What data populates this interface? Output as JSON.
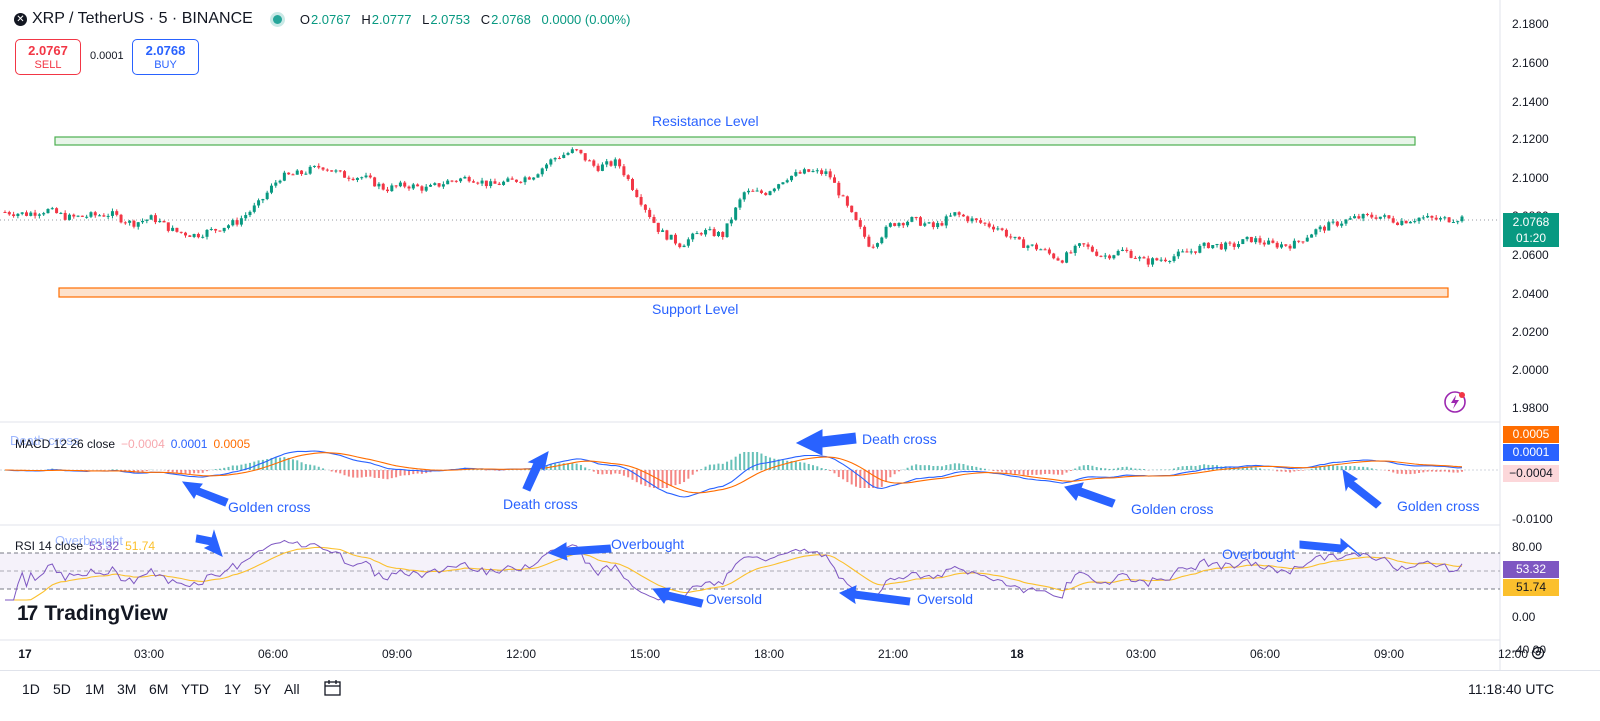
{
  "header": {
    "symbol": "XRP / TetherUS · 5 · BINANCE",
    "ohlc": {
      "o_label": "O",
      "o": "2.0767",
      "h_label": "H",
      "h": "2.0777",
      "l_label": "L",
      "l": "2.0753",
      "c_label": "C",
      "c": "2.0768",
      "change": "0.0000 (0.00%)"
    }
  },
  "trade": {
    "sell_price": "2.0767",
    "sell_label": "SELL",
    "spread": "0.0001",
    "buy_price": "2.0768",
    "buy_label": "BUY"
  },
  "indicators": {
    "macd": {
      "name": "MACD 12 26 close",
      "histogram": "−0.0004",
      "macd": "0.0001",
      "signal": "0.0005"
    },
    "rsi": {
      "name": "RSI 14 close",
      "rsi": "53.32",
      "ma": "51.74"
    }
  },
  "annotations": {
    "resistance": "Resistance Level",
    "support": "Support Level",
    "death_cross_1": "Death cross",
    "death_cross_2": "Death cross",
    "golden_cross_1": "Golden cross",
    "golden_cross_2": "Golden cross",
    "golden_cross_3": "Golden cross",
    "overbought_1": "Overbought",
    "overbought_2": "Overbought",
    "oversold_1": "Oversold",
    "oversold_2": "Oversold",
    "faint_death_cross": "Death cross",
    "faint_overbought": "Overbought"
  },
  "price_axis": [
    "2.1800",
    "2.1600",
    "2.1400",
    "2.1200",
    "2.1000",
    "2.0800",
    "2.0600",
    "2.0400",
    "2.0200",
    "2.0000",
    "1.9800"
  ],
  "macd_axis": [
    "-0.0100"
  ],
  "rsi_axis": [
    "80.00",
    "0.00",
    "-40.00"
  ],
  "price_tags": {
    "last_price": "2.0768",
    "countdown": "01:20",
    "macd_signal": "0.0005",
    "macd_line": "0.0001",
    "macd_hist": "−0.0004",
    "rsi_value": "53.32",
    "rsi_ma": "51.74"
  },
  "time_axis": [
    "17",
    "03:00",
    "06:00",
    "09:00",
    "12:00",
    "15:00",
    "18:00",
    "21:00",
    "18",
    "03:00",
    "06:00",
    "09:00",
    "12:00"
  ],
  "ranges": [
    "1D",
    "5D",
    "1M",
    "3M",
    "6M",
    "YTD",
    "1Y",
    "5Y",
    "All"
  ],
  "clock": "11:18:40 UTC",
  "logo": "TradingView",
  "colors": {
    "up": "#089981",
    "down": "#f23645",
    "macd": "#2962ff",
    "signal": "#ff6d00",
    "rsi": "#7e57c2",
    "rsi_ma": "#fbc02d",
    "annotation": "#2962ff"
  },
  "chart_data": {
    "type": "candlestick",
    "interval_minutes": 5,
    "approx_close_path": [
      [
        0,
        2.08
      ],
      [
        10,
        2.079
      ],
      [
        20,
        2.081
      ],
      [
        30,
        2.077
      ],
      [
        40,
        2.078
      ],
      [
        50,
        2.079
      ],
      [
        60,
        2.074
      ],
      [
        70,
        2.077
      ],
      [
        80,
        2.07
      ],
      [
        90,
        2.068
      ],
      [
        100,
        2.071
      ],
      [
        110,
        2.075
      ],
      [
        120,
        2.084
      ],
      [
        130,
        2.098
      ],
      [
        140,
        2.1
      ],
      [
        150,
        2.104
      ],
      [
        160,
        2.099
      ],
      [
        170,
        2.098
      ],
      [
        180,
        2.092
      ],
      [
        190,
        2.094
      ],
      [
        200,
        2.092
      ],
      [
        210,
        2.096
      ],
      [
        220,
        2.098
      ],
      [
        230,
        2.094
      ],
      [
        240,
        2.096
      ],
      [
        250,
        2.099
      ],
      [
        260,
        2.108
      ],
      [
        270,
        2.112
      ],
      [
        280,
        2.103
      ],
      [
        290,
        2.106
      ],
      [
        300,
        2.088
      ],
      [
        310,
        2.07
      ],
      [
        320,
        2.063
      ],
      [
        330,
        2.07
      ],
      [
        340,
        2.068
      ],
      [
        350,
        2.09
      ],
      [
        360,
        2.09
      ],
      [
        370,
        2.098
      ],
      [
        380,
        2.101
      ],
      [
        390,
        2.1
      ],
      [
        400,
        2.08
      ],
      [
        410,
        2.062
      ],
      [
        420,
        2.074
      ],
      [
        430,
        2.076
      ],
      [
        440,
        2.072
      ],
      [
        450,
        2.079
      ],
      [
        460,
        2.075
      ],
      [
        470,
        2.072
      ],
      [
        480,
        2.064
      ],
      [
        490,
        2.061
      ],
      [
        500,
        2.055
      ],
      [
        510,
        2.063
      ],
      [
        520,
        2.057
      ],
      [
        530,
        2.06
      ],
      [
        540,
        2.054
      ],
      [
        550,
        2.056
      ],
      [
        560,
        2.059
      ],
      [
        570,
        2.063
      ],
      [
        580,
        2.062
      ],
      [
        590,
        2.066
      ],
      [
        600,
        2.063
      ],
      [
        610,
        2.063
      ],
      [
        620,
        2.07
      ],
      [
        630,
        2.074
      ],
      [
        640,
        2.077
      ],
      [
        650,
        2.078
      ],
      [
        660,
        2.075
      ],
      [
        670,
        2.077
      ],
      [
        680,
        2.076
      ],
      [
        690,
        2.077
      ]
    ],
    "resistance_level": 2.1195,
    "support_level": 2.04,
    "last_close": 2.0768,
    "macd": {
      "fast": 12,
      "slow": 26,
      "source": "close",
      "last_hist": -0.0004,
      "last_macd": 0.0001,
      "last_signal": 0.0005
    },
    "rsi": {
      "length": 14,
      "source": "close",
      "last": 53.32,
      "last_ma": 51.74,
      "upper_band": 70,
      "middle_band": 50,
      "lower_band": 30
    }
  }
}
